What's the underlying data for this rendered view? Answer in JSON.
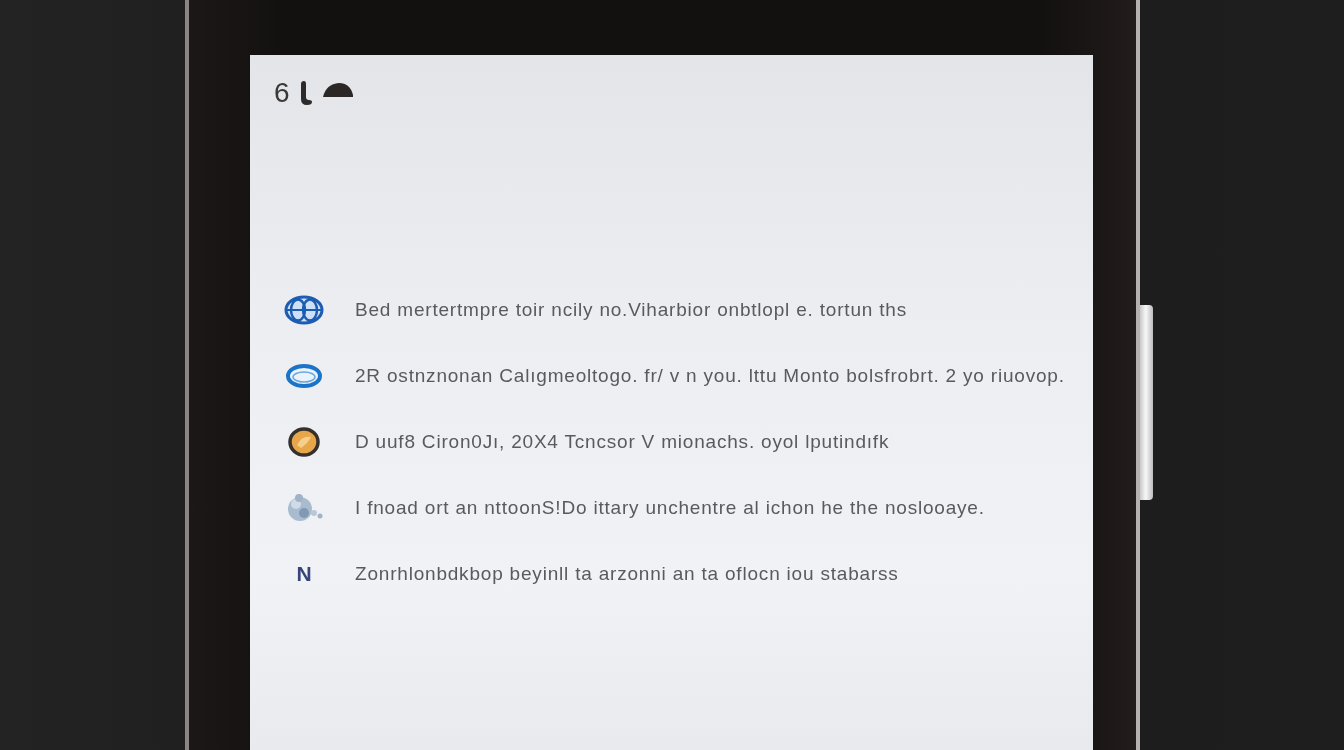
{
  "status_bar": {
    "label": "6"
  },
  "items": [
    {
      "kind": "icon",
      "text": "Bed mertertmpre toir ncily no.Viharbior onbtlopl e. tortun ths"
    },
    {
      "kind": "icon",
      "text": "2R ostnznonan Calıgmeoltogo. fr/ v n you. lttu Monto bolsfrobrt. 2 yo riuovop."
    },
    {
      "kind": "icon",
      "text": "D uuf8 Ciron0Jı, 20X4 Tcncsor V mionachs. oyol lputindıfk"
    },
    {
      "kind": "icon",
      "text": "I fnoad ort an nttoonS!Do ittary unchentre al ichon he the noslooaye."
    },
    {
      "kind": "letter",
      "letter": "N",
      "text": "Zonrhlonbdkbop beyinll ta arzonni an ta oflocn iou stabarss"
    }
  ]
}
